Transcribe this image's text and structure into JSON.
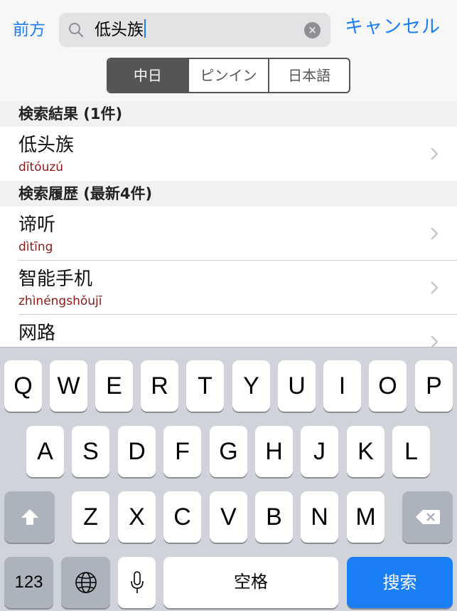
{
  "nav": {
    "back_label": "前方",
    "search_value": "低头族",
    "clear_label": "×",
    "cancel_label": "キャンセル"
  },
  "segments": [
    {
      "label": "中日",
      "active": true
    },
    {
      "label": "ピンイン",
      "active": false
    },
    {
      "label": "日本語",
      "active": false
    }
  ],
  "results": {
    "header": "検索結果 (1件)",
    "items": [
      {
        "word": "低头族",
        "pinyin": "dītóuzú"
      }
    ]
  },
  "history": {
    "header": "検索履歴 (最新4件)",
    "items": [
      {
        "word": "谛听",
        "pinyin": "dìtīng"
      },
      {
        "word": "智能手机",
        "pinyin": "zhìnéngshǒujī"
      },
      {
        "word": "网路",
        "pinyin": ""
      }
    ]
  },
  "keyboard": {
    "row1": [
      "Q",
      "W",
      "E",
      "R",
      "T",
      "Y",
      "U",
      "I",
      "O",
      "P"
    ],
    "row2": [
      "A",
      "S",
      "D",
      "F",
      "G",
      "H",
      "J",
      "K",
      "L"
    ],
    "row3": [
      "Z",
      "X",
      "C",
      "V",
      "B",
      "N",
      "M"
    ],
    "numbers_label": "123",
    "space_label": "空格",
    "search_label": "搜索",
    "icons": {
      "shift": "shift-icon",
      "delete": "delete-icon",
      "globe": "globe-icon",
      "mic": "microphone-icon"
    }
  },
  "colors": {
    "accent": "#1a7ef5",
    "pinyin": "#8a1a1a",
    "segment_active": "#555555"
  }
}
